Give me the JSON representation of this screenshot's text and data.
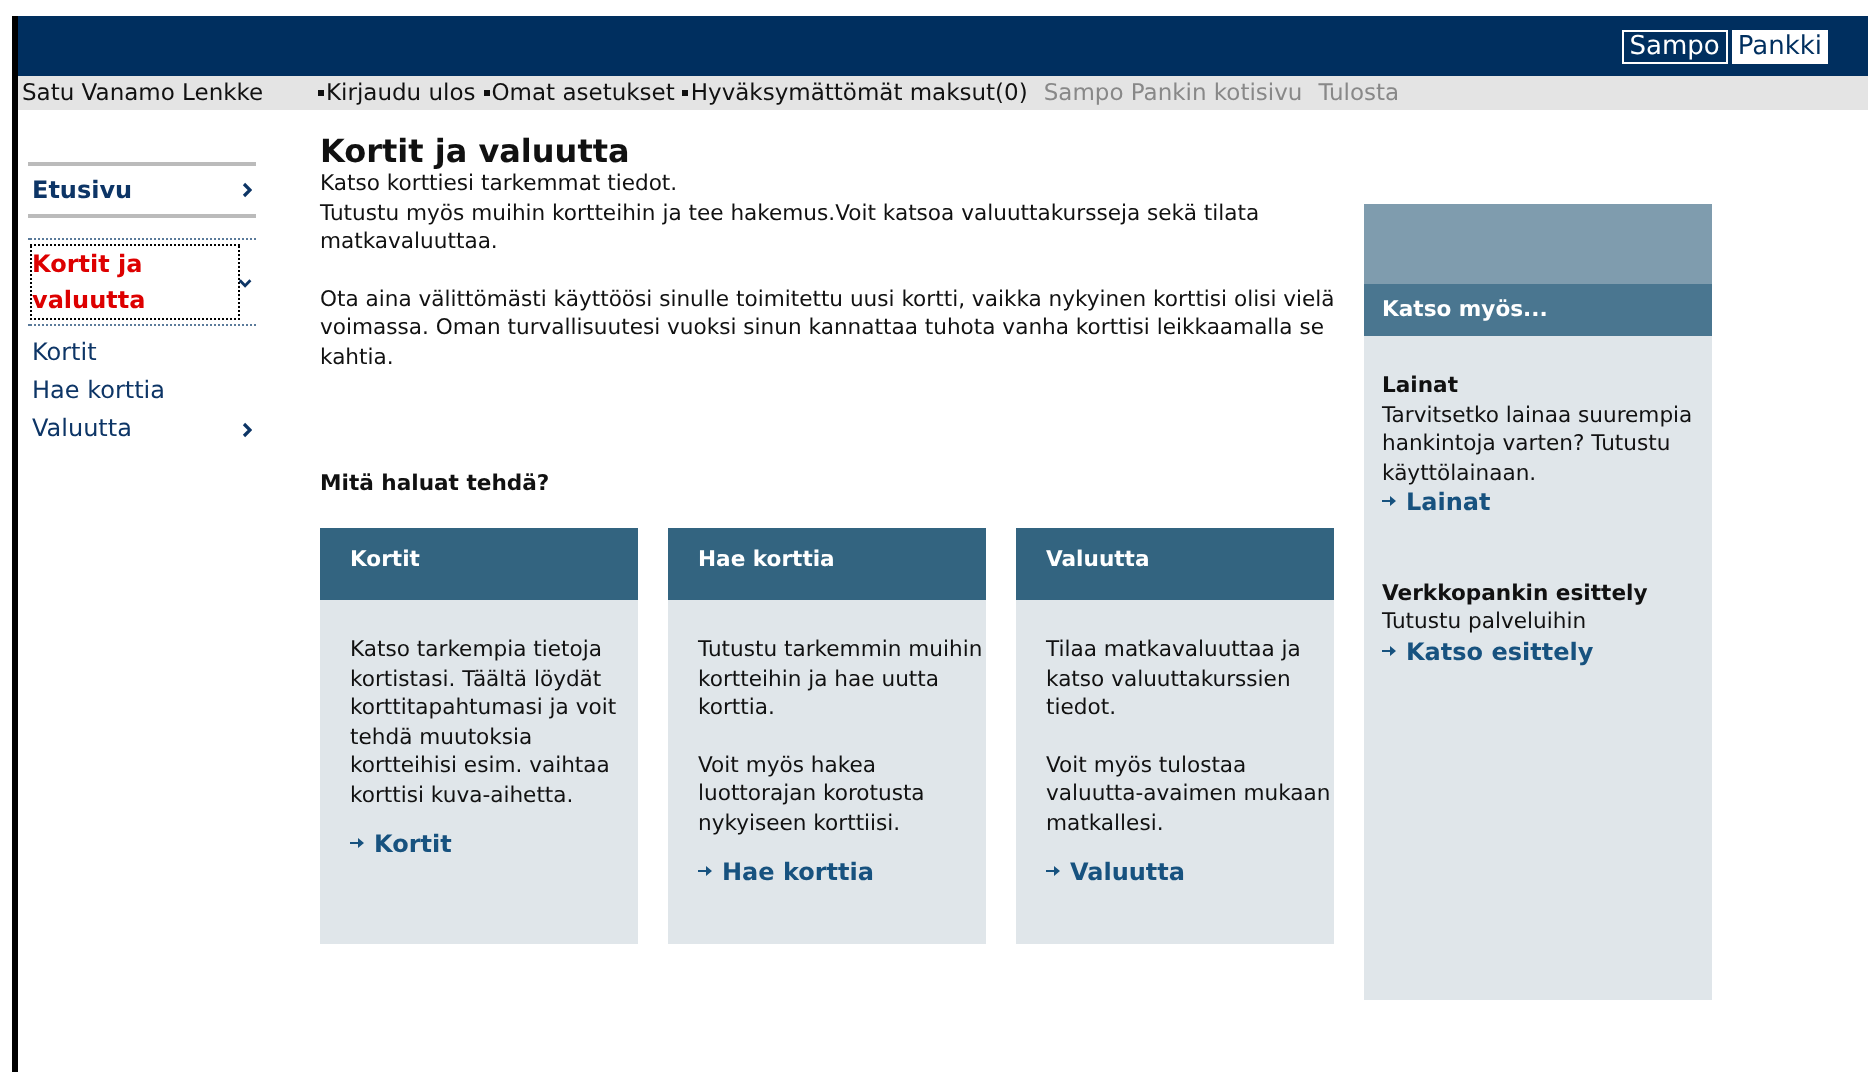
{
  "header": {
    "logo": [
      "Sampo",
      "Pankki"
    ]
  },
  "top_bar": {
    "user": "Satu Vanamo Lenkke",
    "links": [
      {
        "label": "Kirjaudu ulos",
        "kind": "bullet"
      },
      {
        "label": "Omat asetukset",
        "kind": "bullet"
      },
      {
        "label": "Hyväksymättömät maksut(0)",
        "kind": "bullet"
      },
      {
        "label": "Sampo Pankin kotisivu",
        "kind": "plain"
      },
      {
        "label": "Tulosta",
        "kind": "plain"
      }
    ]
  },
  "sidebar": {
    "items": [
      {
        "label": "Etusivu",
        "selected": false,
        "has_submenu": true,
        "expanded": false
      },
      {
        "label": "Kortit ja valuutta",
        "selected": true,
        "has_submenu": true,
        "expanded": true,
        "children": [
          {
            "label": "Kortit",
            "has_submenu": false
          },
          {
            "label": "Hae korttia",
            "has_submenu": false
          },
          {
            "label": "Valuutta",
            "has_submenu": true
          }
        ]
      }
    ]
  },
  "main": {
    "title": "Kortit ja valuutta",
    "paragraphs": [
      "Katso korttiesi tarkemmat tiedot.\nTutustu myös muihin kortteihin ja tee hakemus.Voit katsoa valuuttakursseja sekä tilata matkavaluuttaa.",
      "Ota aina välittömästi käyttöösi sinulle toimitettu uusi kortti, vaikka nykyinen korttisi olisi vielä voimassa. Oman turvallisuutesi vuoksi sinun kannattaa tuhota vanha korttisi leikkaamalla se kahtia."
    ],
    "question": "Mitä haluat tehdä?",
    "cards": [
      {
        "title": "Kortit",
        "texts": [
          "Katso tarkempia tietoja kortistasi. Täältä löydät korttitapahtumasi ja voit tehdä muutoksia kortteihisi esim. vaihtaa korttisi kuva-aihetta."
        ],
        "link": "Kortit"
      },
      {
        "title": "Hae korttia",
        "texts": [
          "Tutustu tarkemmin muihin kortteihin ja hae uutta korttia.",
          "Voit myös hakea luottorajan korotusta nykyiseen korttiisi."
        ],
        "link": "Hae korttia"
      },
      {
        "title": "Valuutta",
        "texts": [
          "Tilaa matkavaluuttaa ja katso valuuttakurssien tiedot.",
          "Voit myös tulostaa valuutta-avaimen mukaan matkallesi."
        ],
        "link": "Valuutta"
      }
    ]
  },
  "aside": {
    "title": "Katso myös...",
    "sections": [
      {
        "heading": "Lainat",
        "text": "Tarvitsetko lainaa suurempia hankintoja varten? Tutustu käyttölainaan.",
        "link": "Lainat"
      },
      {
        "heading": "Verkkopankin esittely",
        "text": "Tutustu palveluihin",
        "link": "Katso esittely"
      }
    ]
  }
}
